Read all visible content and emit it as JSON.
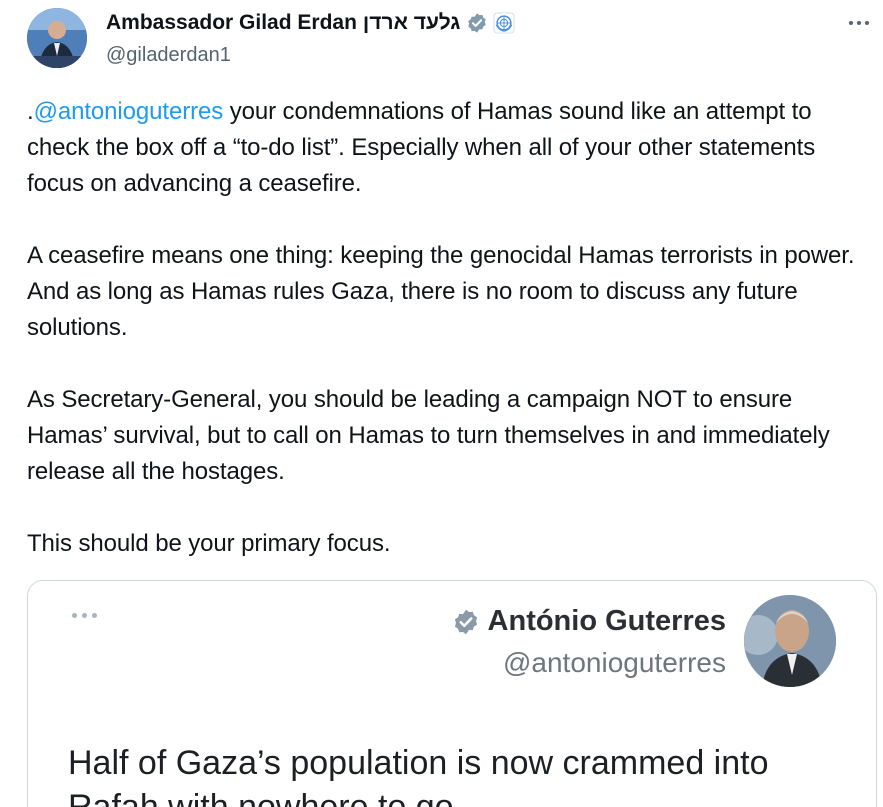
{
  "author": {
    "display_name": "Ambassador Gilad Erdan",
    "hebrew_name": "גלעד ארדן",
    "handle": "@giladerdan1",
    "verified_icon": "verified-badge-icon",
    "affiliation_icon": "un-emblem-icon"
  },
  "more_menu": {
    "icon": "more-horizontal-icon"
  },
  "tweet": {
    "p1_prefix": ".",
    "p1_mention": "@antonioguterres",
    "p1_rest": " your condemnations of Hamas sound like an attempt to check the box off a “to-do list”. Especially when all of your other statements focus on advancing a ceasefire.",
    "p2": "A ceasefire means one thing: keeping the genocidal Hamas terrorists in power. And as long as Hamas rules Gaza, there is no room to discuss any future solutions.",
    "p3": "As Secretary-General, you should be leading a campaign NOT to ensure Hamas’ survival, but to call on Hamas to turn themselves in and immediately release all the hostages.",
    "p4": "This should be your primary focus."
  },
  "quoted": {
    "display_name": "António Guterres",
    "handle": "@antonioguterres",
    "verified_icon": "verified-badge-icon",
    "text": "Half of Gaza’s population is now crammed into Rafah with nowhere to go."
  },
  "colors": {
    "link": "#1d9bf0",
    "text": "#0f1419",
    "secondary": "#536471",
    "border": "#cfd9de"
  }
}
